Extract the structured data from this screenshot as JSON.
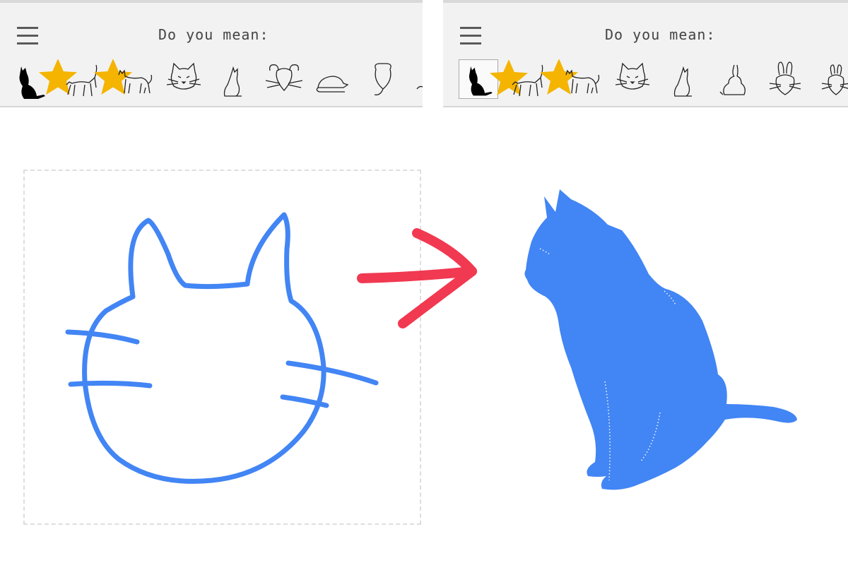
{
  "left_panel": {
    "prompt": "Do you mean:",
    "menu_icon": "hamburger-menu-icon",
    "suggestions": [
      {
        "name": "sitting-cat-silhouette-icon",
        "starred": true
      },
      {
        "name": "walking-cat-icon",
        "starred": true
      },
      {
        "name": "standing-cat-icon",
        "starred": false
      },
      {
        "name": "cat-face-icon",
        "starred": false
      },
      {
        "name": "sitting-cat-outline-icon",
        "starred": false
      },
      {
        "name": "mouse-face-icon",
        "starred": false
      },
      {
        "name": "mouse-icon",
        "starred": false
      },
      {
        "name": "mouse-top-view-icon",
        "starred": false
      },
      {
        "name": "partial-icon",
        "starred": false
      }
    ]
  },
  "right_panel": {
    "prompt": "Do you mean:",
    "menu_icon": "hamburger-menu-icon",
    "selected_index": 0,
    "suggestions": [
      {
        "name": "sitting-cat-silhouette-icon",
        "starred": true
      },
      {
        "name": "walking-cat-icon",
        "starred": true
      },
      {
        "name": "standing-cat-icon",
        "starred": false
      },
      {
        "name": "cat-face-icon",
        "starred": false
      },
      {
        "name": "sitting-cat-outline-icon",
        "starred": false
      },
      {
        "name": "rabbit-icon",
        "starred": false
      },
      {
        "name": "rabbit-face-icon",
        "starred": false
      },
      {
        "name": "rabbit-face-small-icon",
        "starred": false
      }
    ]
  },
  "colors": {
    "stroke_blue": "#4285f4",
    "arrow_red": "#f0243f",
    "star_gold": "#f4b400",
    "bar_bg": "#f2f2f2"
  }
}
